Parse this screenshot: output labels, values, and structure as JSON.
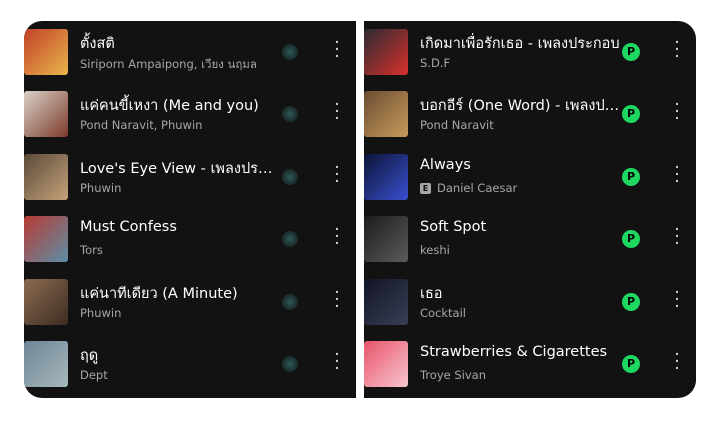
{
  "left_list": [
    {
      "title": "ตั้งสติ",
      "artist": "Siriporn Ampaipong, เวียง นฤมล",
      "explicit": false,
      "thumb_colors": [
        "#c2412a",
        "#e9b54a"
      ]
    },
    {
      "title": "แค่คนขี้เหงา (Me and you)",
      "artist": "Pond Naravit, Phuwin",
      "explicit": false,
      "thumb_colors": [
        "#d9d2c7",
        "#7c3a2b"
      ]
    },
    {
      "title": "Love's Eye View - เพลงประกอบ",
      "artist": "Phuwin",
      "explicit": false,
      "thumb_colors": [
        "#5a4a3a",
        "#c6a27a"
      ]
    },
    {
      "title": "Must Confess",
      "artist": "Tors",
      "explicit": false,
      "thumb_colors": [
        "#b83a32",
        "#5c8fa8"
      ]
    },
    {
      "title": "แค่นาทีเดียว (A Minute)",
      "artist": "Phuwin",
      "explicit": false,
      "thumb_colors": [
        "#8b6b50",
        "#3d2c22"
      ]
    },
    {
      "title": "ฤดู",
      "artist": "Dept",
      "explicit": false,
      "thumb_colors": [
        "#6c8593",
        "#a9b8bf"
      ]
    }
  ],
  "right_list": [
    {
      "title": "เกิดมาเพื่อรักเธอ - เพลงประกอบ",
      "artist": "S.D.F",
      "explicit": false,
      "thumb_colors": [
        "#2b2b33",
        "#d8312b"
      ]
    },
    {
      "title": "บอกอีร์ (One Word) - เพลงประกอบ",
      "artist": "Pond Naravit",
      "explicit": false,
      "thumb_colors": [
        "#6b4d32",
        "#c79a5b"
      ]
    },
    {
      "title": "Always",
      "artist": "Daniel Caesar",
      "explicit": true,
      "thumb_colors": [
        "#0c1436",
        "#3a4fd0"
      ]
    },
    {
      "title": "Soft Spot",
      "artist": "keshi",
      "explicit": false,
      "thumb_colors": [
        "#1c1c1c",
        "#5b5b5b"
      ]
    },
    {
      "title": "เธอ",
      "artist": "Cocktail",
      "explicit": false,
      "thumb_colors": [
        "#111525",
        "#3a3f55"
      ]
    },
    {
      "title": "Strawberries & Cigarettes",
      "artist": "Troye Sivan",
      "explicit": false,
      "thumb_colors": [
        "#e8546a",
        "#f7c6cf"
      ]
    }
  ],
  "badges": {
    "explicit_label": "E",
    "premium_label": "P"
  },
  "colors": {
    "background": "#121212",
    "accent": "#1ed760",
    "text": "#ffffff",
    "subtext": "#a7a7a7"
  }
}
